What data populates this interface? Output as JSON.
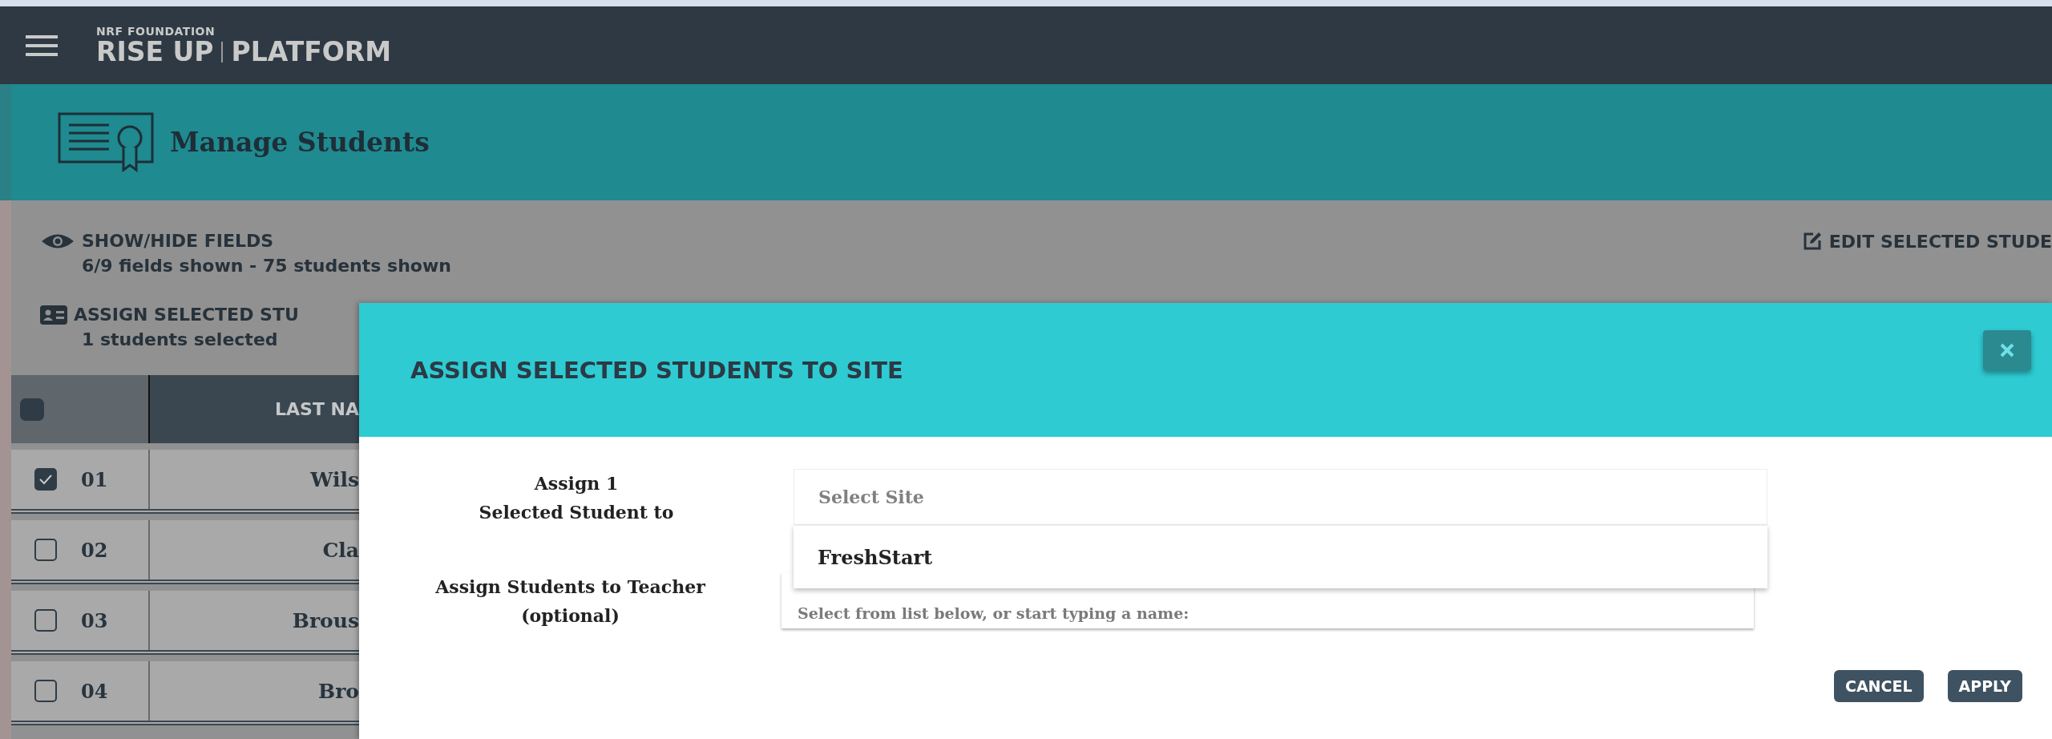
{
  "top_bar": {
    "logo_small": "NRF FOUNDATION",
    "logo_main": "RISE UP",
    "logo_sub": "PLATFORM"
  },
  "page_header": {
    "title": "Manage Students"
  },
  "toolbar": {
    "show_hide": {
      "label": "SHOW/HIDE FIELDS",
      "detail": "6/9 fields shown - 75 students shown"
    },
    "edit": {
      "label": "EDIT SELECTED STUDE"
    },
    "assign": {
      "label": "ASSIGN SELECTED STU",
      "detail": "1 students selected"
    }
  },
  "table": {
    "select_all": {
      "partial": true
    },
    "columns": [
      "LAST NA"
    ],
    "rows": [
      {
        "number": "01",
        "last_name": "Wils",
        "checked": true
      },
      {
        "number": "02",
        "last_name": "Cla",
        "checked": false
      },
      {
        "number": "03",
        "last_name": "Brous",
        "checked": false
      },
      {
        "number": "04",
        "last_name": "Bro",
        "checked": false
      }
    ]
  },
  "dialog": {
    "title": "ASSIGN SELECTED STUDENTS TO SITE",
    "site": {
      "label_lines": [
        "Assign 1",
        "Selected Student to"
      ],
      "placeholder": "Select Site",
      "options": [
        {
          "label": "FreshStart",
          "selected": false
        }
      ]
    },
    "teacher": {
      "label_lines": [
        "Assign Students to Teacher",
        "(optional)"
      ],
      "placeholder": "Select from list below, or start typing a name:"
    },
    "buttons": [
      "CANCEL",
      "APPLY"
    ]
  }
}
